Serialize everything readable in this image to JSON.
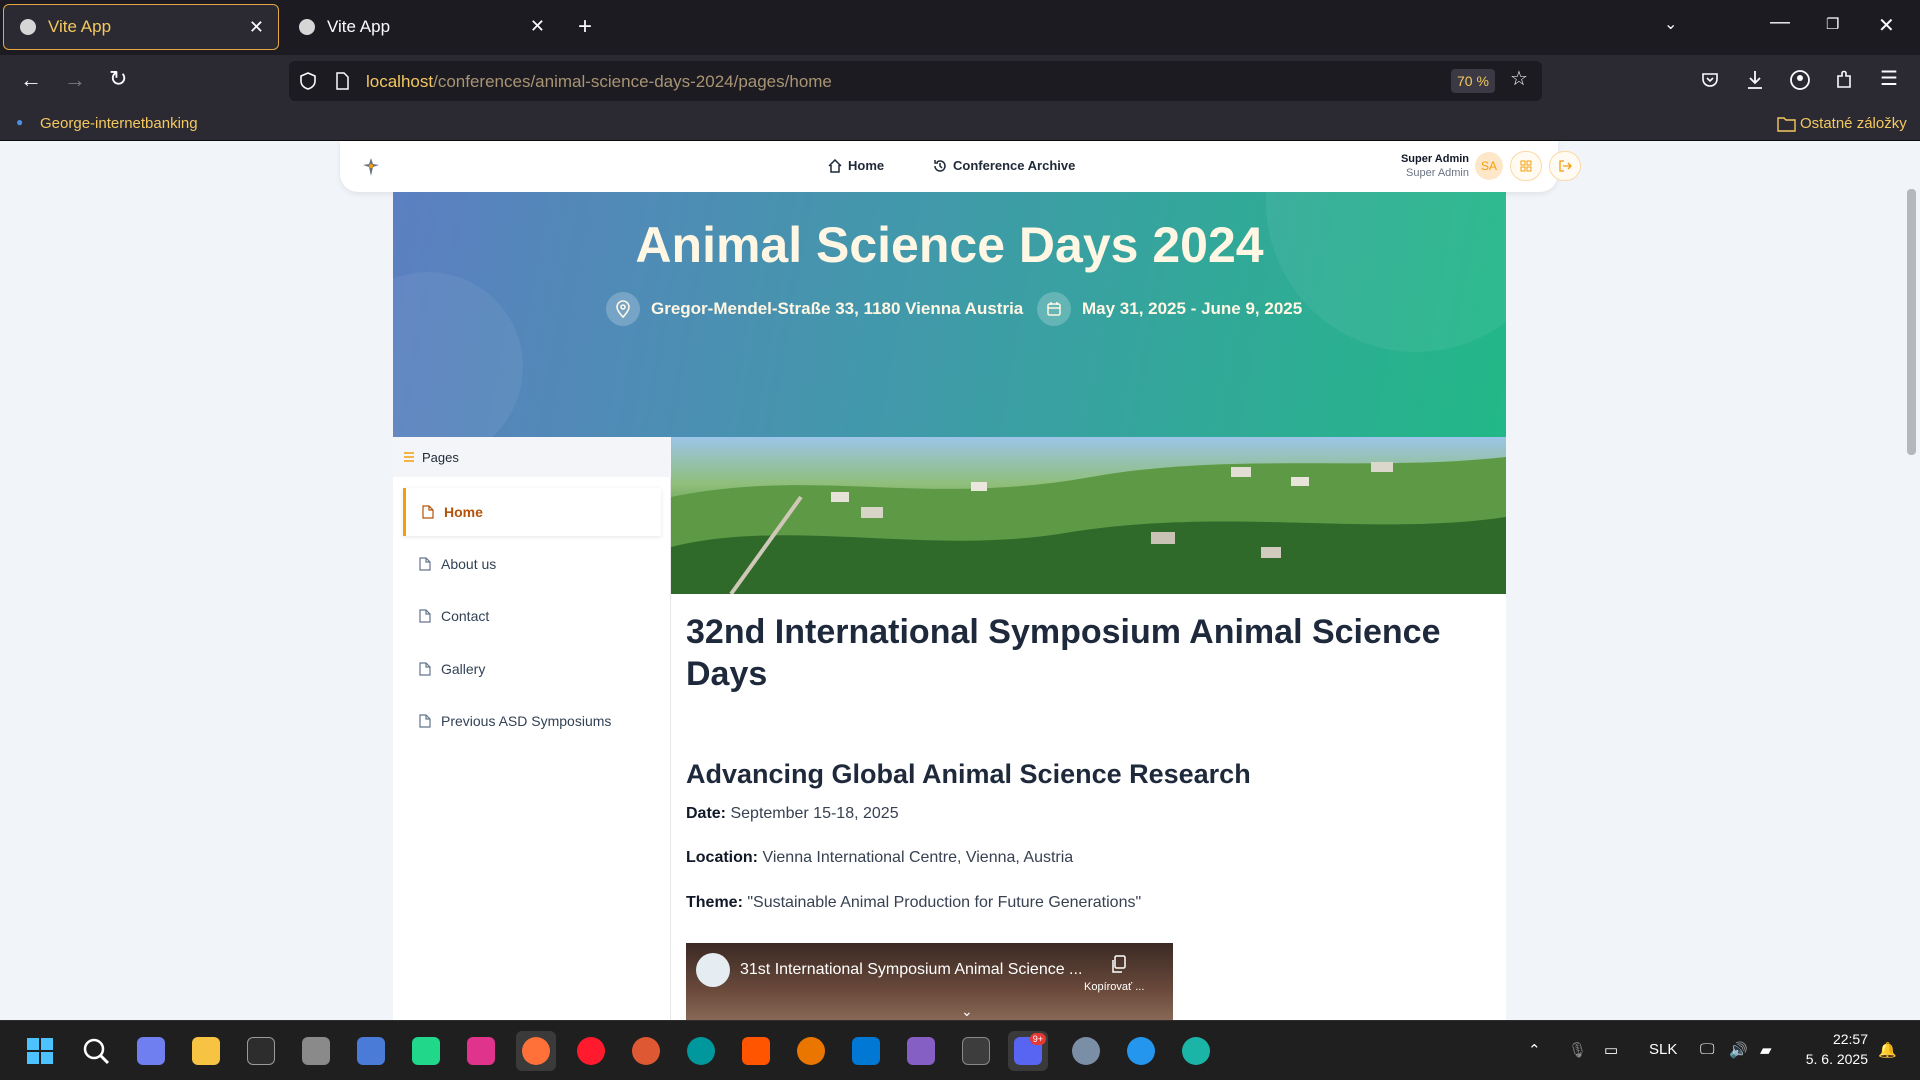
{
  "browser": {
    "tabs": [
      {
        "title": "Vite App",
        "active": true
      },
      {
        "title": "Vite App",
        "active": false
      }
    ],
    "url_host": "localhost",
    "url_path": "/conferences/animal-science-days-2024/pages/home",
    "zoom": "70 %",
    "bookmarks": {
      "left": "George-internetbanking",
      "right": "Ostatné záložky"
    }
  },
  "appnav": {
    "links": [
      {
        "label": "Home",
        "icon": "home-icon"
      },
      {
        "label": "Conference Archive",
        "icon": "history-icon"
      }
    ],
    "user_name": "Super Admin",
    "user_role": "Super Admin",
    "avatar_initials": "SA"
  },
  "hero": {
    "title": "Animal Science Days 2024",
    "address": "Gregor-Mendel-Straße 33, 1180 Vienna Austria",
    "dates": "May 31, 2025 - June 9, 2025"
  },
  "sidebar": {
    "heading": "Pages",
    "items": [
      {
        "label": "Home",
        "active": true
      },
      {
        "label": "About us",
        "active": false
      },
      {
        "label": "Contact",
        "active": false
      },
      {
        "label": "Gallery",
        "active": false
      },
      {
        "label": "Previous ASD Symposiums",
        "active": false
      }
    ]
  },
  "content": {
    "title": "32nd International Symposium Animal Science Days",
    "subtitle": "Advancing Global Animal Science Research",
    "date_label": "Date:",
    "date_value": "September 15-18, 2025",
    "location_label": "Location:",
    "location_value": "Vienna International Centre, Vienna, Austria",
    "theme_label": "Theme:",
    "theme_value": "\"Sustainable Animal Production for Future Generations\"",
    "video_title": "31st International Symposium Animal Science ...",
    "video_copy": "Kopírovať ..."
  },
  "taskbar": {
    "lang": "SLK",
    "time": "22:57",
    "date": "5. 6. 2025",
    "discord_badge": "9+"
  },
  "colors": {
    "accent": "#f59e0b",
    "hero_start": "#5c7fc1",
    "hero_end": "#22b887",
    "browser_dark": "#1c1b22"
  }
}
